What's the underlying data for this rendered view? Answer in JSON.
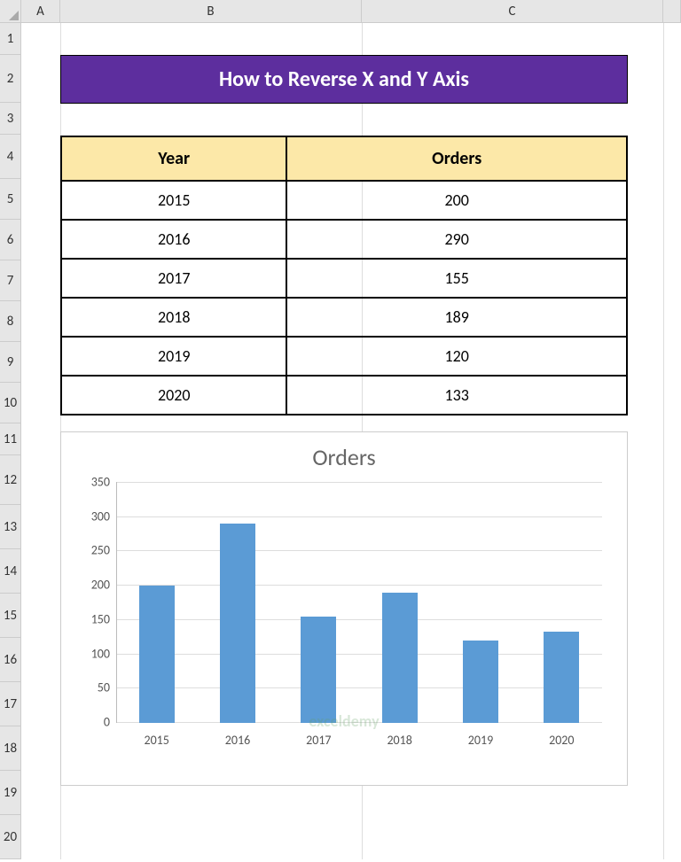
{
  "columns": [
    "A",
    "B",
    "C"
  ],
  "rows": [
    "1",
    "2",
    "3",
    "4",
    "5",
    "6",
    "7",
    "8",
    "9",
    "10",
    "11",
    "12",
    "13",
    "14",
    "15",
    "16",
    "17",
    "18",
    "19",
    "20"
  ],
  "title": "How to Reverse X and Y Axis",
  "table": {
    "headers": {
      "year": "Year",
      "orders": "Orders"
    },
    "rows": [
      {
        "year": "2015",
        "orders": "200"
      },
      {
        "year": "2016",
        "orders": "290"
      },
      {
        "year": "2017",
        "orders": "155"
      },
      {
        "year": "2018",
        "orders": "189"
      },
      {
        "year": "2019",
        "orders": "120"
      },
      {
        "year": "2020",
        "orders": "133"
      }
    ]
  },
  "watermark": "exceldemy",
  "chart_data": {
    "type": "bar",
    "title": "Orders",
    "xlabel": "",
    "ylabel": "",
    "ylim": [
      0,
      350
    ],
    "ystep": 50,
    "categories": [
      "2015",
      "2016",
      "2017",
      "2018",
      "2019",
      "2020"
    ],
    "values": [
      200,
      290,
      155,
      189,
      120,
      133
    ],
    "y_ticks": [
      "0",
      "50",
      "100",
      "150",
      "200",
      "250",
      "300",
      "350"
    ]
  }
}
